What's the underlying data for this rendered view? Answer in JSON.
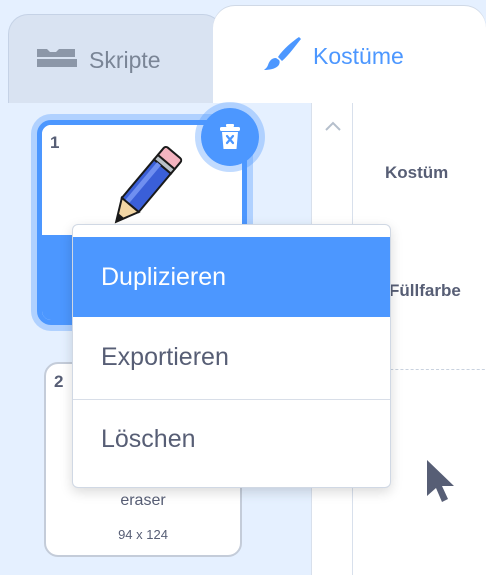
{
  "tabs": {
    "scripts_label": "Skripte",
    "costumes_label": "Kostüme"
  },
  "costumes": [
    {
      "number": "1",
      "thumbnail": "pencil"
    },
    {
      "number": "2",
      "name": "eraser",
      "size": "94 x 124"
    }
  ],
  "context_menu": {
    "items": [
      "Duplizieren",
      "Exportieren",
      "Löschen"
    ],
    "active_index": 0
  },
  "editor": {
    "costume_label": "Kostüm",
    "fill_label": "Füllfarbe"
  },
  "colors": {
    "accent": "#4c97ff",
    "text": "#575e75",
    "panel_bg": "#e5f0ff"
  },
  "icons": {
    "scripts_tab": "code-blocks-icon",
    "costumes_tab": "paintbrush-icon",
    "delete": "trash-icon",
    "scroll_up": "chevron-up-icon",
    "select_tool": "arrow-cursor-icon"
  }
}
